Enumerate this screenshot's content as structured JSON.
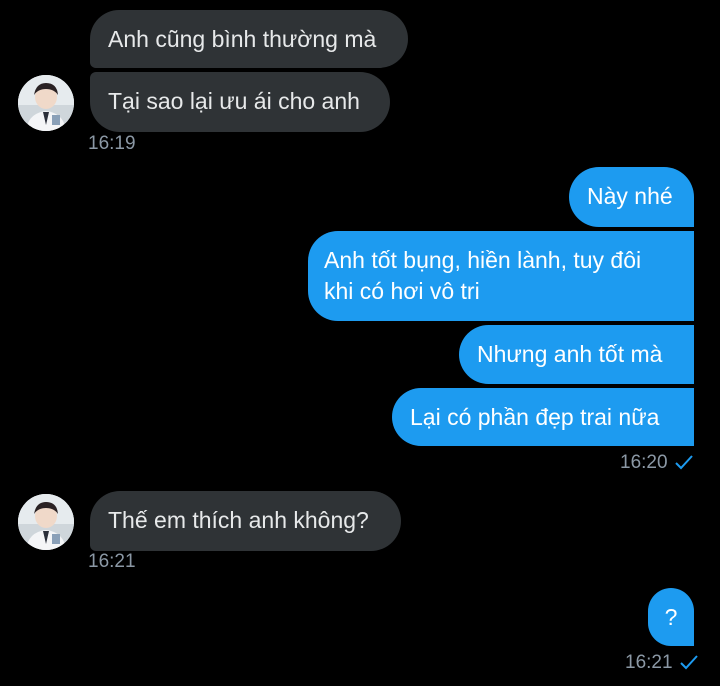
{
  "messages": {
    "m1": "Anh cũng bình thường mà",
    "m2": "Tại sao lại ưu ái cho anh",
    "t1": "16:19",
    "m3": "Này nhé",
    "m4": "Anh tốt bụng, hiền lành, tuy đôi khi có hơi vô tri",
    "m5": "Nhưng anh tốt mà",
    "m6": "Lại có phần đẹp trai nữa",
    "t2": "16:20",
    "m7": "Thế em thích anh không?",
    "t3": "16:21",
    "m8": "?",
    "t4": "16:21"
  },
  "icons": {
    "sent_check": "check-icon",
    "avatar": "contact-avatar"
  },
  "colors": {
    "background": "#000000",
    "incoming_bubble": "#2f3336",
    "outgoing_bubble": "#1d9bf0",
    "timestamp": "#8b98a5",
    "check": "#1d9bf0"
  }
}
